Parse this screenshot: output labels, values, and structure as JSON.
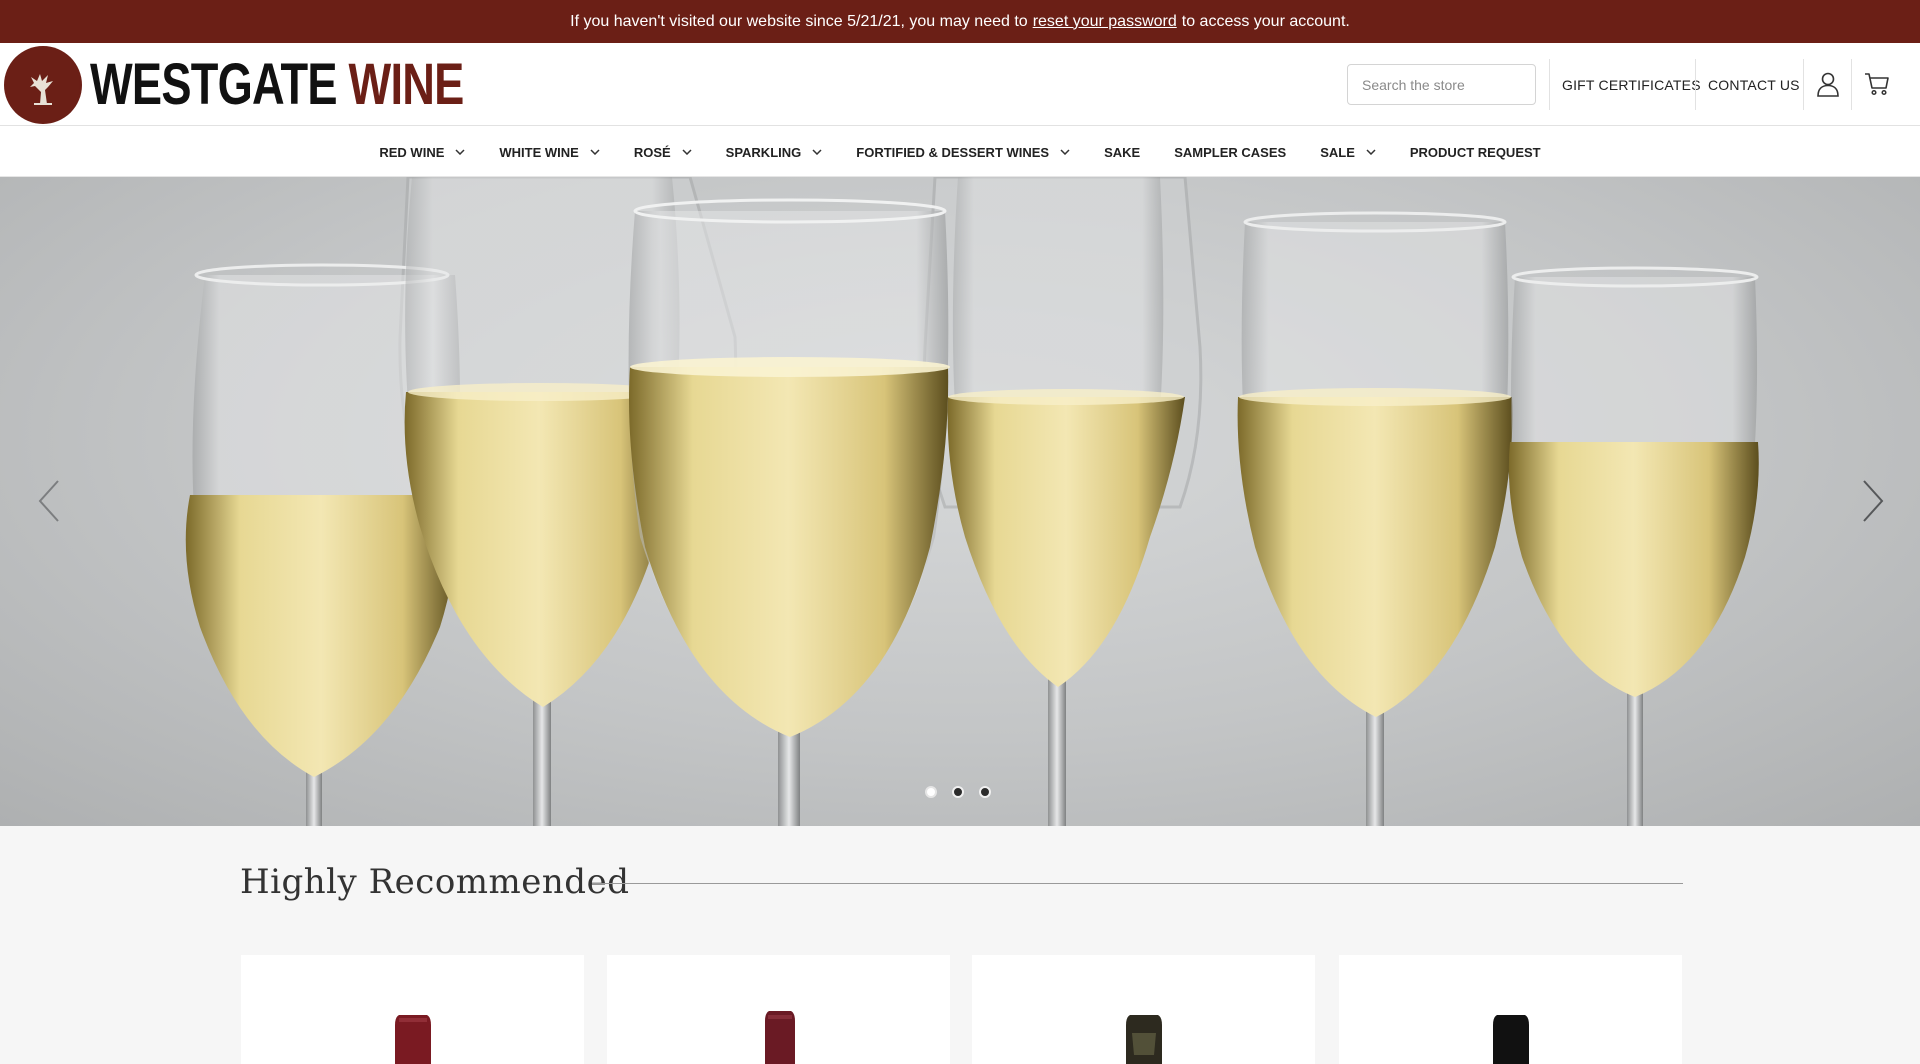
{
  "announcement": {
    "text_before": "If you haven't visited our website since 5/21/21, you may need to",
    "link": "reset your password",
    "text_after": "to access your account.",
    "color": "#6b1f16"
  },
  "header": {
    "brand_part1": "WESTGATE",
    "brand_part2": "WINE",
    "brand_color": "#6b1f16",
    "search_placeholder": "Search the store",
    "links": {
      "gift_certificates": "GIFT CERTIFICATES",
      "contact_us": "CONTACT US"
    },
    "icons": [
      "account-icon",
      "cart-icon"
    ]
  },
  "nav": {
    "items": [
      {
        "label": "RED WINE",
        "dropdown": true
      },
      {
        "label": "WHITE WINE",
        "dropdown": true
      },
      {
        "label": "ROSÉ",
        "dropdown": true
      },
      {
        "label": "SPARKLING",
        "dropdown": true
      },
      {
        "label": "FORTIFIED & DESSERT WINES",
        "dropdown": true
      },
      {
        "label": "SAKE",
        "dropdown": false
      },
      {
        "label": "SAMPLER CASES",
        "dropdown": false
      },
      {
        "label": "SALE",
        "dropdown": true
      },
      {
        "label": "PRODUCT REQUEST",
        "dropdown": false
      }
    ]
  },
  "hero": {
    "slide_count": 3,
    "active_slide": 1,
    "controls": [
      "chevron-left-icon",
      "chevron-right-icon"
    ]
  },
  "recommended": {
    "title": "Highly Recommended",
    "products": [
      {
        "capsule_color": "#7a1a22"
      },
      {
        "capsule_color": "#6a1a24"
      },
      {
        "capsule_color": "#2d2a1f"
      },
      {
        "capsule_color": "#111111"
      }
    ]
  }
}
